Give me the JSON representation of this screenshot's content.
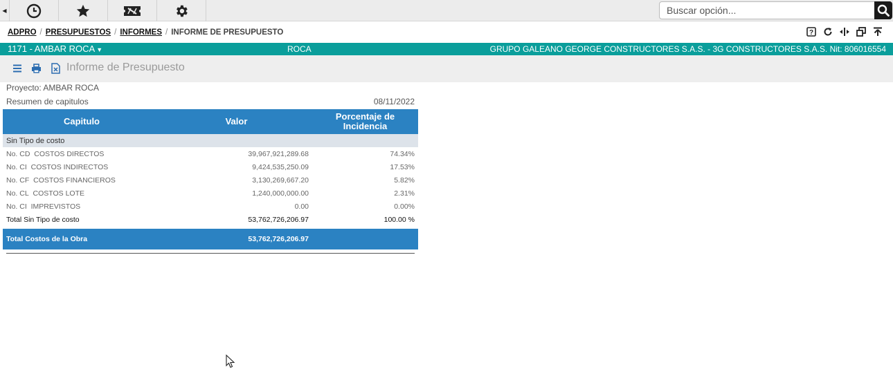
{
  "toolbar": {
    "icons": [
      "clock-icon",
      "star-icon",
      "ticket-icon",
      "gear-icon"
    ],
    "search_placeholder": "Buscar opción..."
  },
  "breadcrumb": {
    "items": [
      "ADPRO",
      "PRESUPUESTOS",
      "INFORMES"
    ],
    "current": "INFORME DE PRESUPUESTO"
  },
  "project_bar": {
    "project": "1171 - AMBAR ROCA",
    "center": "ROCA",
    "company": "GRUPO GALEANO GEORGE CONSTRUCTORES S.A.S. - 3G CONSTRUCTORES S.A.S. Nit: 806016554"
  },
  "page": {
    "title": "Informe de Presupuesto"
  },
  "report": {
    "project_label": "Proyecto: AMBAR ROCA",
    "summary_label": "Resumen de capitulos",
    "date": "08/11/2022",
    "columns": [
      "Capitulo",
      "Valor",
      "Porcentaje de Incidencia"
    ],
    "group_label": "Sin Tipo de costo",
    "rows": [
      {
        "code": "No. CD",
        "name": "COSTOS DIRECTOS",
        "value": "39,967,921,289.68",
        "pct": "74.34%"
      },
      {
        "code": "No. CI",
        "name": "COSTOS INDIRECTOS",
        "value": "9,424,535,250.09",
        "pct": "17.53%"
      },
      {
        "code": "No. CF",
        "name": "COSTOS FINANCIEROS",
        "value": "3,130,269,667.20",
        "pct": "5.82%"
      },
      {
        "code": "No. CL",
        "name": "COSTOS LOTE",
        "value": "1,240,000,000.00",
        "pct": "2.31%"
      },
      {
        "code": "No. CI",
        "name": "IMPREVISTOS",
        "value": "0.00",
        "pct": "0.00%"
      }
    ],
    "subtotal": {
      "label": "Total Sin Tipo de costo",
      "value": "53,762,726,206.97",
      "pct": "100.00 %"
    },
    "grand_total": {
      "label": "Total Costos de la Obra",
      "value": "53,762,726,206.97"
    }
  },
  "colors": {
    "teal": "#0a9e9b",
    "table_header": "#2b82c2"
  }
}
